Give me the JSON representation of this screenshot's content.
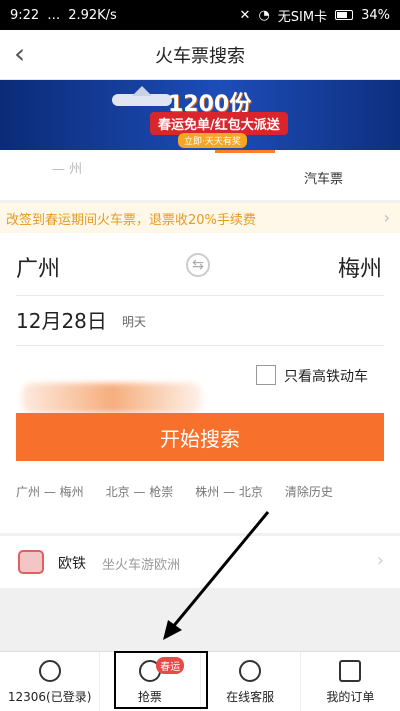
{
  "status_bar": {
    "time": "9:22",
    "speed": "2.92K/s",
    "sim": "无SIM卡",
    "battery": "34%"
  },
  "header": {
    "title": "火车票搜索"
  },
  "banner": {
    "headline": "1200份",
    "subline": "春运免单/红包大派送",
    "pill": "立即·天天有奖"
  },
  "tabs": {
    "bus": "汽车票",
    "ghost": "— 州"
  },
  "notice": {
    "text": "改签到春运期间火车票，退票收20%手续费"
  },
  "search": {
    "from": "广州",
    "to": "梅州",
    "date": "12月28日",
    "day": "明天",
    "only_high_speed": "只看高铁动车",
    "button": "开始搜索"
  },
  "history": [
    "广州 — 梅州",
    "北京 — 枪崇",
    "株州 — 北京",
    "清除历史"
  ],
  "promo": {
    "title": "欧铁",
    "subtitle": "坐火车游欧洲"
  },
  "bottom_nav": [
    {
      "label": "12306(已登录)"
    },
    {
      "label": "抢票",
      "badge": "春运"
    },
    {
      "label": "在线客服"
    },
    {
      "label": "我的订单"
    }
  ],
  "colors": {
    "accent": "#f7712d",
    "notice": "#e89a22"
  }
}
